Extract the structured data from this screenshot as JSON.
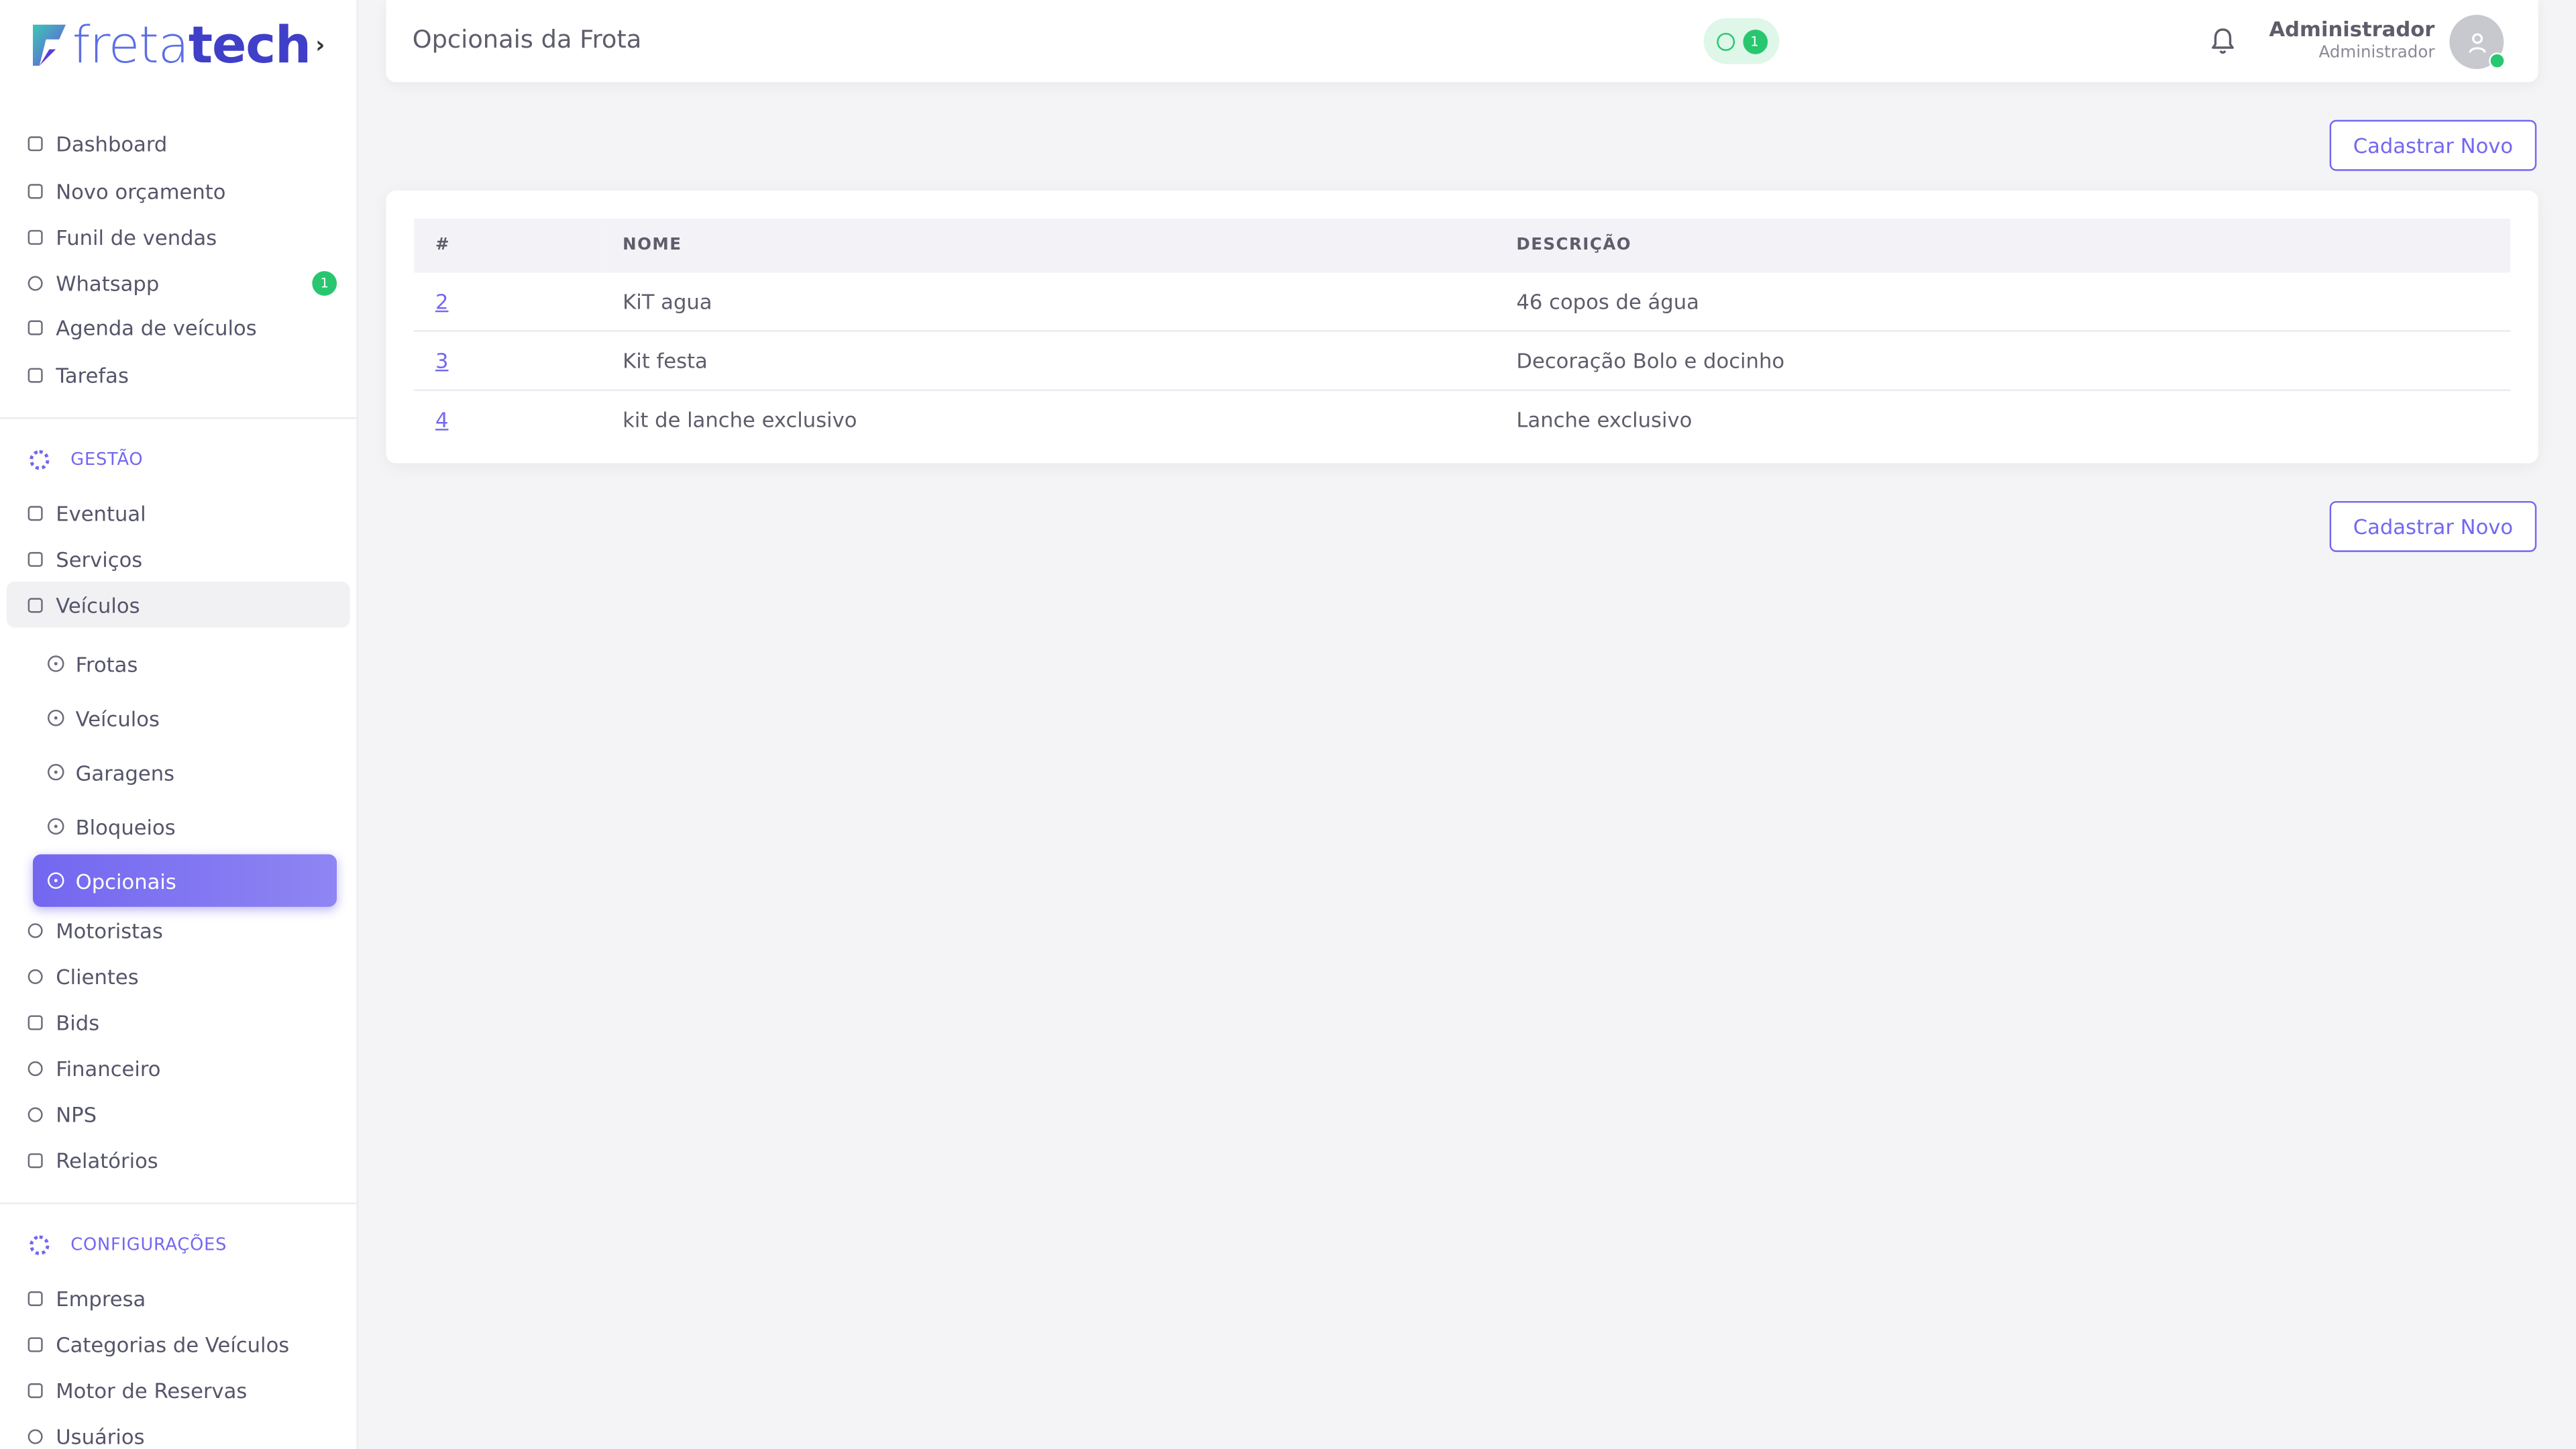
{
  "brand": {
    "logo_light": "freta",
    "logo_bold": "tech",
    "accent": "#7367f0",
    "success": "#28c76f"
  },
  "sidebar": {
    "toggle_icon": "chevron-right-icon",
    "main_items": [
      {
        "label": "Dashboard",
        "icon": "home-icon"
      },
      {
        "label": "Novo orçamento",
        "icon": "edit-icon"
      },
      {
        "label": "Funil de vendas",
        "icon": "funnel-icon"
      },
      {
        "label": "Whatsapp",
        "icon": "whatsapp-icon",
        "badge": "1"
      },
      {
        "label": "Agenda de veículos",
        "icon": "calendar-icon"
      },
      {
        "label": "Tarefas",
        "icon": "list-icon"
      }
    ],
    "gestao": {
      "heading": "GESTÃO",
      "items": [
        {
          "label": "Eventual",
          "icon": "file-icon"
        },
        {
          "label": "Serviços",
          "icon": "clipboard-icon"
        },
        {
          "label": "Veículos",
          "icon": "bus-icon"
        }
      ],
      "vehicle_subitems": [
        {
          "label": "Frotas"
        },
        {
          "label": "Veículos"
        },
        {
          "label": "Garagens"
        },
        {
          "label": "Bloqueios"
        },
        {
          "label": "Opcionais"
        }
      ],
      "more_items": [
        {
          "label": "Motoristas",
          "icon": "steering-icon"
        },
        {
          "label": "Clientes",
          "icon": "users-icon"
        },
        {
          "label": "Bids",
          "icon": "gavel-icon"
        },
        {
          "label": "Financeiro",
          "icon": "dollar-icon"
        },
        {
          "label": "NPS",
          "icon": "chat-icon"
        },
        {
          "label": "Relatórios",
          "icon": "report-icon"
        }
      ]
    },
    "config": {
      "heading": "CONFIGURAÇÕES",
      "items": [
        {
          "label": "Empresa",
          "icon": "building-icon"
        },
        {
          "label": "Categorias de Veículos",
          "icon": "grid-icon"
        },
        {
          "label": "Motor de Reservas",
          "icon": "table-icon"
        },
        {
          "label": "Usuários",
          "icon": "user-icon"
        }
      ]
    }
  },
  "header": {
    "title": "Opcionais da Frota",
    "whatsapp_count": "1",
    "user_name": "Administrador",
    "user_role": "Administrador"
  },
  "actions": {
    "create_label": "Cadastrar Novo"
  },
  "table": {
    "columns": [
      "#",
      "NOME",
      "DESCRIÇÃO"
    ],
    "rows": [
      {
        "id": "2",
        "nome": "KiT agua",
        "descricao": "46 copos de água"
      },
      {
        "id": "3",
        "nome": "Kit festa",
        "descricao": "Decoração Bolo e docinho"
      },
      {
        "id": "4",
        "nome": "kit de lanche exclusivo",
        "descricao": "Lanche exclusivo"
      }
    ]
  }
}
